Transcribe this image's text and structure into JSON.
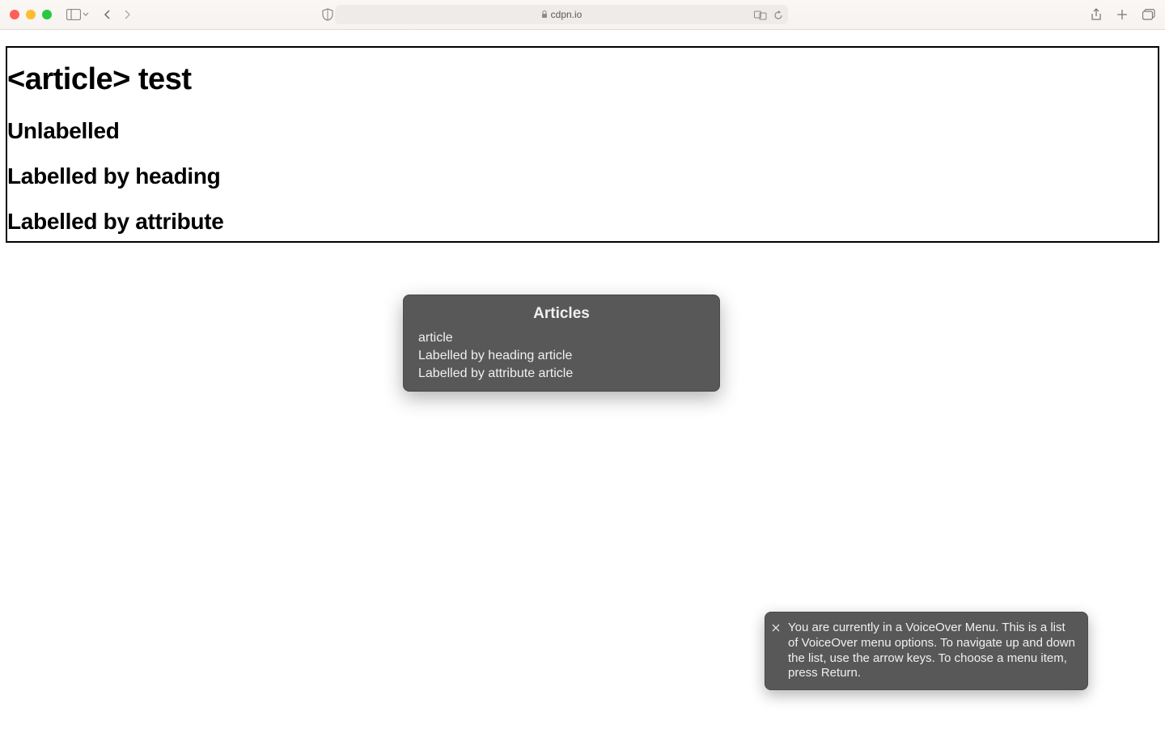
{
  "browser": {
    "url_domain": "cdpn.io"
  },
  "page": {
    "h1": "<article> test",
    "h2_unlabelled": "Unlabelled",
    "h2_labelled_heading": "Labelled by heading",
    "h2_labelled_attribute": "Labelled by attribute"
  },
  "voiceover_rotor": {
    "title": "Articles",
    "items": [
      "article",
      "Labelled by heading article",
      "Labelled by attribute article"
    ]
  },
  "voiceover_caption": {
    "text": "You are currently in a VoiceOver Menu. This is a list of VoiceOver menu options. To navigate up and down the list, use the arrow keys. To choose a menu item, press Return."
  }
}
